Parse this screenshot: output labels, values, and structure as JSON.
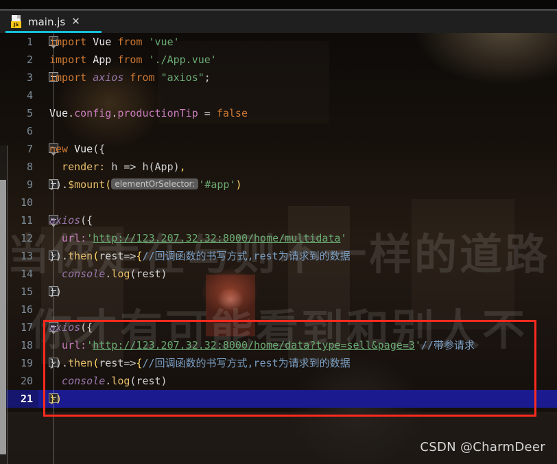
{
  "window": {
    "theme_background": "#1e1e1e",
    "accent": "#16c0d8"
  },
  "tab": {
    "filename": "main.js",
    "icon": "javascript-file-icon",
    "badge": "JS",
    "close_label": "✕",
    "underline_color": "#16c0d8"
  },
  "editor": {
    "language": "javascript",
    "current_line": 21,
    "selection_color": "#1b1b8f",
    "lines": [
      {
        "n": 1,
        "indent": 0,
        "fold": "open"
      },
      {
        "n": 2,
        "indent": 0,
        "fold": ""
      },
      {
        "n": 3,
        "indent": 0,
        "fold": "close"
      },
      {
        "n": 4,
        "indent": 0,
        "fold": ""
      },
      {
        "n": 5,
        "indent": 0,
        "fold": ""
      },
      {
        "n": 6,
        "indent": 0,
        "fold": ""
      },
      {
        "n": 7,
        "indent": 0,
        "fold": "open"
      },
      {
        "n": 8,
        "indent": 0,
        "fold": ""
      },
      {
        "n": 9,
        "indent": 0,
        "fold": "close"
      },
      {
        "n": 10,
        "indent": 0,
        "fold": ""
      },
      {
        "n": 11,
        "indent": 0,
        "fold": "open"
      },
      {
        "n": 12,
        "indent": 0,
        "fold": ""
      },
      {
        "n": 13,
        "indent": 0,
        "fold": "close"
      },
      {
        "n": 14,
        "indent": 0,
        "fold": ""
      },
      {
        "n": 15,
        "indent": 0,
        "fold": "close"
      },
      {
        "n": 16,
        "indent": 0,
        "fold": ""
      },
      {
        "n": 17,
        "indent": 0,
        "fold": "open"
      },
      {
        "n": 18,
        "indent": 0,
        "fold": ""
      },
      {
        "n": 19,
        "indent": 0,
        "fold": "close"
      },
      {
        "n": 20,
        "indent": 0,
        "fold": ""
      },
      {
        "n": 21,
        "indent": 0,
        "fold": "close"
      }
    ],
    "line_numbers": [
      "1",
      "2",
      "3",
      "4",
      "5",
      "6",
      "7",
      "8",
      "9",
      "10",
      "11",
      "12",
      "13",
      "14",
      "15",
      "16",
      "17",
      "18",
      "19",
      "20",
      "21"
    ],
    "code": {
      "l1_import": "import ",
      "l1_name": "Vue",
      "l1_from": " from ",
      "l1_module": "'vue'",
      "l2_import": "import ",
      "l2_name": "App",
      "l2_from": " from ",
      "l2_module": "'./App.vue'",
      "l3_import": "import ",
      "l3_name": "axios",
      "l3_from": " from ",
      "l3_module": "\"axios\"",
      "l3_semi": ";",
      "l5_obj": "Vue",
      "l5_dot1": ".",
      "l5_config": "config",
      "l5_dot2": ".",
      "l5_prop": "productionTip",
      "l5_eq": " = ",
      "l5_val": "false",
      "l7_new": "new ",
      "l7_cls": "Vue",
      "l7_open": "({",
      "l8_key": "  render: ",
      "l8_h": "h => h(App)",
      "l8_comma": ",",
      "l9_close": "}).",
      "l9_mount": "$mount",
      "l9_paren": "(",
      "l9_hint": "elementOrSelector:",
      "l9_arg": "'#app'",
      "l9_end": ")",
      "l11_fn": "axios",
      "l11_open": "({",
      "l12_key": "  url:",
      "l12_q1": "'",
      "l12_url": "http://123.207.32.32:8000/home/multidata",
      "l12_q2": "'",
      "l13_close": "}).",
      "l13_then": "then",
      "l13_p1": "(",
      "l13_arrow": "rest=>",
      "l13_brace": "{",
      "l13_comment": "//回调函数的书写方式,rest为请求到的数据",
      "l14_obj": "  console",
      "l14_dot": ".",
      "l14_log": "log",
      "l14_args": "(rest)",
      "l15_close": "})",
      "l17_fn": "axios",
      "l17_open": "({",
      "l18_key": "  url:",
      "l18_q1": "'",
      "l18_url": "http://123.207.32.32:8000/home/data?type=sell&page=3",
      "l18_q2": "'",
      "l18_comment": "//带参请求",
      "l19_close": "}).",
      "l19_then": "then",
      "l19_p1": "(",
      "l19_arrow": "rest=>",
      "l19_brace": "{",
      "l19_comment": "//回调函数的书写方式,rest为请求到的数据",
      "l20_obj": "  console",
      "l20_dot": ".",
      "l20_log": "log",
      "l20_args": "(rest)",
      "l21_close": "})"
    }
  },
  "annotation": {
    "type": "red-rectangle-highlight",
    "color": "#ff2a1f",
    "covers_lines": "17-21"
  },
  "background_watermark": {
    "line1": "当你走在与则不一样的道路",
    "line2": "你才有可能看到和别人不"
  },
  "footer": {
    "watermark": "CSDN @CharmDeer"
  }
}
